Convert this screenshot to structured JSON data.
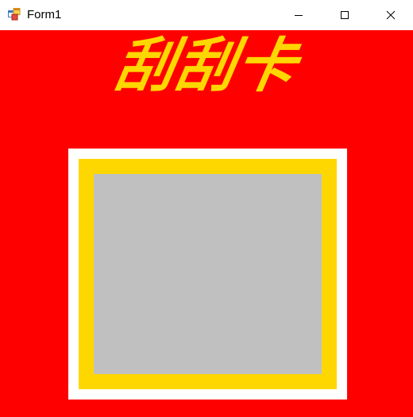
{
  "window": {
    "title": "Form1",
    "icon": "winforms-app-icon",
    "controls": {
      "minimize_icon": "minimize-icon",
      "maximize_icon": "maximize-icon",
      "close_icon": "close-icon"
    }
  },
  "main": {
    "headline": "刮刮卡",
    "colors": {
      "background": "#ff0000",
      "headline": "#ffd700",
      "frame_outer": "#ffffff",
      "frame_inner": "#ffd700",
      "scratch_surface": "#c0c0c0"
    }
  }
}
